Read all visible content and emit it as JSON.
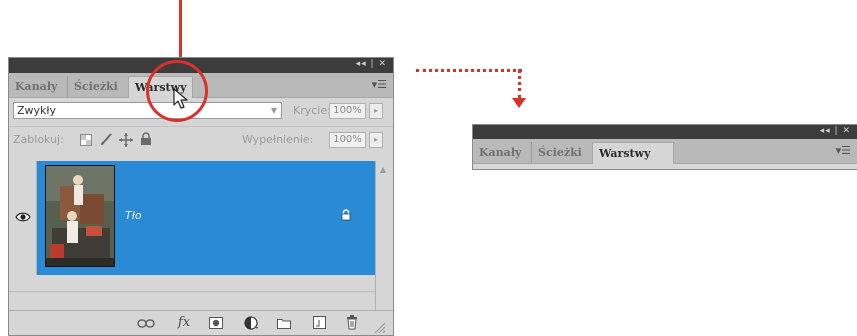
{
  "colors": {
    "annotation": "#d8322b",
    "selected_layer": "#2a8ad6",
    "titlebar": "#3c3c3c",
    "panel_bg": "#d6d6d6"
  },
  "panel_big": {
    "titlebar": {
      "controls": "◂◂ | ✕"
    },
    "tabs": [
      {
        "label": "Kanały",
        "active": false
      },
      {
        "label": "Ścieżki",
        "active": false
      },
      {
        "label": "Warstwy",
        "active": true
      }
    ],
    "menu_icon": "panel-menu-icon",
    "blend_mode": {
      "value": "Zwykły"
    },
    "opacity": {
      "label": "Krycie:",
      "value": "100%"
    },
    "lock": {
      "label": "Zablokuj:",
      "icons": [
        "lock-transparent-icon",
        "lock-brush-icon",
        "lock-move-icon",
        "lock-all-icon"
      ]
    },
    "fill": {
      "label": "Wypełnienie:",
      "value": "100%"
    },
    "layer": {
      "name": "Tło",
      "visible": true,
      "locked": true
    },
    "bottom_icons": [
      "link-icon",
      "fx-icon",
      "mask-icon",
      "adjustment-icon",
      "group-icon",
      "new-layer-icon",
      "trash-icon"
    ],
    "fx_label": "fx"
  },
  "panel_small": {
    "titlebar": {
      "controls": "◂◂ | ✕"
    },
    "tabs": [
      {
        "label": "Kanały",
        "active": false
      },
      {
        "label": "Ścieżki",
        "active": false
      },
      {
        "label": "Warstwy",
        "active": true
      }
    ]
  }
}
